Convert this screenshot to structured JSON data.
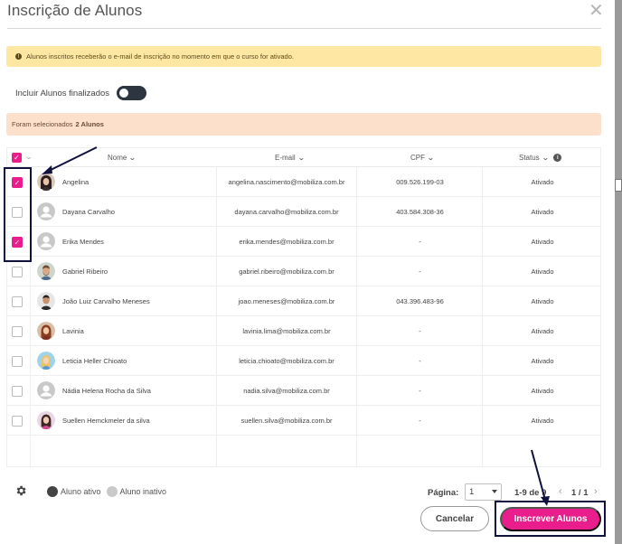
{
  "modal": {
    "title": "Inscrição de Alunos",
    "close_glyph": "✕"
  },
  "alert": {
    "icon_glyph": "!",
    "text": "Alunos inscritos receberão o e-mail de inscrição no momento em que o curso for ativado."
  },
  "toggle": {
    "label": "Incluir Alunos finalizados",
    "on": false
  },
  "selection": {
    "prefix": "Foram selecionados",
    "count_text": "2 Alunos"
  },
  "table": {
    "columns": {
      "name": "Nome",
      "email": "E-mail",
      "cpf": "CPF",
      "status": "Status"
    },
    "info_glyph": "i",
    "check_glyph": "✓",
    "rows": [
      {
        "name": "Angelina",
        "email": "angelina.nascimento@mobiliza.com.br",
        "cpf": "009.526.199-03",
        "status": "Ativado",
        "checked": true,
        "avatar": "photo-dark-hair"
      },
      {
        "name": "Dayana Carvalho",
        "email": "dayana.carvalho@mobiliza.com.br",
        "cpf": "403.584.308-36",
        "status": "Ativado",
        "checked": false,
        "avatar": "default"
      },
      {
        "name": "Erika Mendes",
        "email": "erika.mendes@mobiliza.com.br",
        "cpf": "-",
        "status": "Ativado",
        "checked": true,
        "avatar": "default"
      },
      {
        "name": "Gabriel Ribeiro",
        "email": "gabriel.ribeiro@mobiliza.com.br",
        "cpf": "-",
        "status": "Ativado",
        "checked": false,
        "avatar": "photo-man-beard"
      },
      {
        "name": "João Luiz Carvalho Meneses",
        "email": "joao.meneses@mobiliza.com.br",
        "cpf": "043.396.483-96",
        "status": "Ativado",
        "checked": false,
        "avatar": "photo-man"
      },
      {
        "name": "Lavinia",
        "email": "lavinia.lima@mobiliza.com.br",
        "cpf": "-",
        "status": "Ativado",
        "checked": false,
        "avatar": "photo-woman-red"
      },
      {
        "name": "Leticia Heller Chioato",
        "email": "leticia.chioato@mobiliza.com.br",
        "cpf": "-",
        "status": "Ativado",
        "checked": false,
        "avatar": "photo-illustration-blue"
      },
      {
        "name": "Nádia Helena Rocha da Silva",
        "email": "nadia.silva@mobiliza.com.br",
        "cpf": "-",
        "status": "Ativado",
        "checked": false,
        "avatar": "default"
      },
      {
        "name": "Suellen Hemckmeler da silva",
        "email": "suellen.silva@mobiliza.com.br",
        "cpf": "-",
        "status": "Ativado",
        "checked": false,
        "avatar": "photo-woman-pink"
      }
    ]
  },
  "footer": {
    "legend_active": "Aluno ativo",
    "legend_inactive": "Aluno inativo",
    "page_label": "Página:",
    "page_value": "1",
    "range": "1-9 de 9",
    "prev_glyph": "‹",
    "next_glyph": "›",
    "page_count": "1 / 1",
    "cancel_label": "Cancelar",
    "submit_label": "Inscrever Alunos"
  },
  "colors": {
    "accent": "#e91e8c",
    "alert_bg": "#fde7a2",
    "selected_bg": "#fde0cc",
    "annotation": "#10123d",
    "legend_active": "#444444",
    "legend_inactive": "#c9c9c9"
  }
}
